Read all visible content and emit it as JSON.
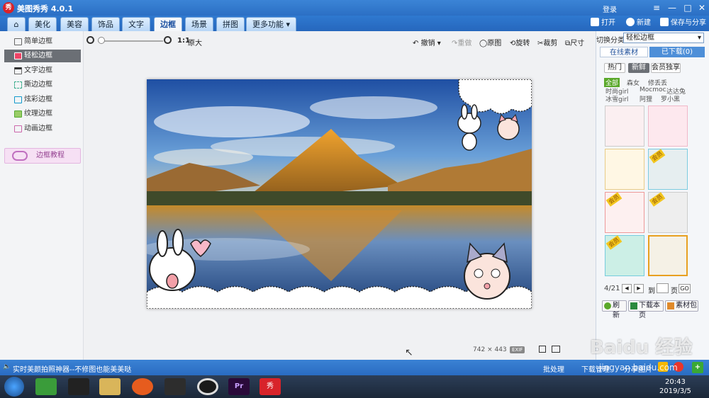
{
  "app": {
    "title": "美图秀秀 4.0.1",
    "logo_text": "秀",
    "login": "登录"
  },
  "window_controls": [
    "≡",
    "—",
    "□",
    "✕"
  ],
  "tabs": {
    "home": "⌂",
    "items": [
      "美化",
      "美容",
      "饰品",
      "文字",
      "边框",
      "场景",
      "拼图",
      "更多功能 ▾"
    ],
    "active": "边框"
  },
  "top_actions": {
    "open": "打开",
    "new": "新建",
    "save_share": "保存与分享"
  },
  "sidebar": {
    "items": [
      "简单边框",
      "轻松边框",
      "文字边框",
      "撕边边框",
      "炫彩边框",
      "纹理边框",
      "动画边框"
    ],
    "selected": "轻松边框",
    "tutorial": "边框教程"
  },
  "toolbar": {
    "ratio": "1:1",
    "original_size": "原大",
    "undo": "撤销",
    "redo": "重做",
    "original": "原图",
    "rotate": "旋转",
    "crop": "裁剪",
    "resize": "尺寸"
  },
  "image_info": {
    "width": "742",
    "x": "×",
    "height": "443",
    "exif": "EXIF"
  },
  "right_panel": {
    "category_label": "切换分类",
    "category_value": "轻松边框",
    "tab_online": "在线素材",
    "tab_downloaded": "已下载(0)",
    "filters": [
      "热门",
      "新鲜",
      "会员独享"
    ],
    "active_filter": "新鲜",
    "tags_row1": [
      "全部",
      "森女",
      "修丢丢"
    ],
    "tags_row2": [
      "时尚girl",
      "Mocmoc",
      "达达兔"
    ],
    "tags_row3": [
      "冰雪girl",
      "阿狸",
      "罗小黑"
    ],
    "badge": "会员",
    "page": "4/21",
    "page_to": "到",
    "page_unit": "页",
    "go": "GO",
    "btn_refresh": "刷新",
    "btn_download_page": "下载本页",
    "btn_library": "素材包"
  },
  "statusbar": {
    "text": "实时美颜拍照神器--不修图也能美美哒",
    "batch": "批处理",
    "download_mgr": "下载管理",
    "share_pic": "分享图片"
  },
  "taskbar": {
    "time": "20:43",
    "date": "2019/3/5"
  },
  "watermark": {
    "text": "Baidu 经验",
    "url": "jingyan.baidu.com"
  },
  "colors": {
    "accent": "#2b6fc4",
    "selected_side": "#6b6f75",
    "tag_green": "#5aa82a",
    "member_badge": "#f2c51e"
  }
}
